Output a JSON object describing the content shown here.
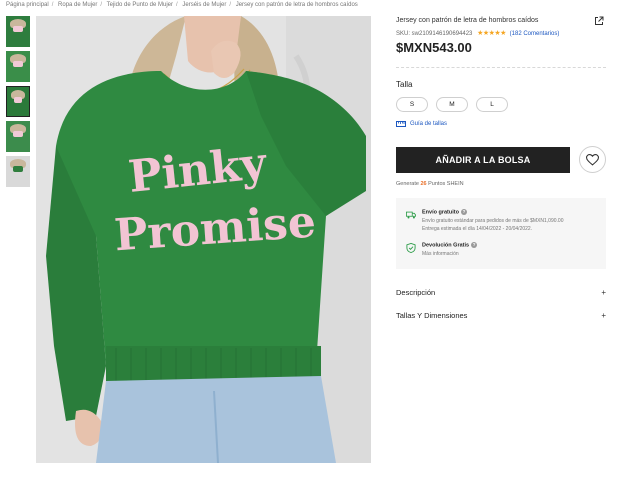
{
  "breadcrumb": [
    "Página principal",
    "Ropa de Mujer",
    "Tejido de Punto de Mujer",
    "Jerséis de Mujer",
    "Jersey con patrón de letra de hombros caídos"
  ],
  "product": {
    "title": "Jersey con patrón de letra de hombros caídos",
    "sku_label": "SKU: sw2109146190694423",
    "rating_stars": "★★★★★",
    "reviews": "(182 Comentarios)",
    "price": "$MXN543.00"
  },
  "image": {
    "sweater_text_line1": "Pinky",
    "sweater_text_line2": "Promise",
    "colors": {
      "sweater": "#2f8a41",
      "print": "#f2c4d3",
      "wall": "#e3e3e3",
      "denim": "#a9c3dc"
    }
  },
  "size": {
    "title": "Talla",
    "options": [
      "S",
      "M",
      "L"
    ],
    "guide": "Guía de tallas"
  },
  "actions": {
    "add_to_bag": "AÑADIR A LA BOLSA"
  },
  "points": {
    "prefix": "Generate",
    "value": "26",
    "suffix": "Puntos SHEIN"
  },
  "shipping": {
    "free_title": "Envío gratuito",
    "free_line1": "Envío gratuito estándar para pedidos de más de $MXN1,090.00",
    "free_line2": "Entrega estimada el día 14/04/2022 - 20/04/2022.",
    "return_title": "Devolución Gratis",
    "return_more": "Más información"
  },
  "accordion": [
    {
      "label": "Descripción",
      "toggle": "+"
    },
    {
      "label": "Tallas Y Dimensiones",
      "toggle": "+"
    }
  ],
  "accent_color": "#1c57c0"
}
